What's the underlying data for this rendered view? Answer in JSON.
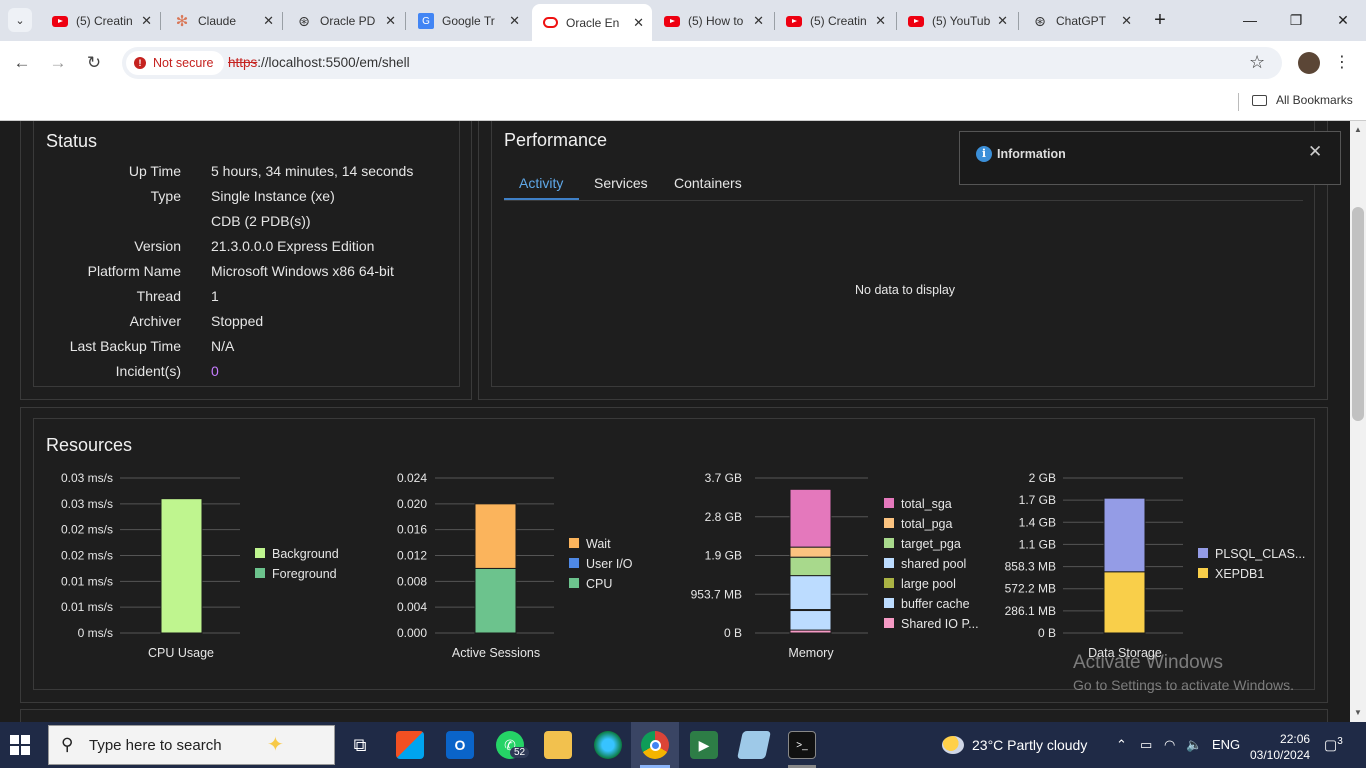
{
  "browser": {
    "tabs": [
      {
        "title": "(5) Creatin",
        "icon": "youtube-icon"
      },
      {
        "title": "Claude",
        "icon": "claude-icon"
      },
      {
        "title": "Oracle PD",
        "icon": "openai-icon"
      },
      {
        "title": "Google Tr",
        "icon": "google-translate-icon"
      },
      {
        "title": "Oracle En",
        "icon": "oracle-icon",
        "active": true
      },
      {
        "title": "(5) How to",
        "icon": "youtube-icon"
      },
      {
        "title": "(5) Creatin",
        "icon": "youtube-icon"
      },
      {
        "title": "(5) YouTub",
        "icon": "youtube-icon"
      },
      {
        "title": "ChatGPT",
        "icon": "openai-icon"
      }
    ],
    "security_chip": "Not secure",
    "url_scheme": "https",
    "url_rest": "://localhost:5500/em/shell",
    "all_bookmarks": "All Bookmarks"
  },
  "status": {
    "title": "Status",
    "rows": [
      {
        "label": "Up Time",
        "value": "5 hours, 34 minutes, 14 seconds"
      },
      {
        "label": "Type",
        "value": "Single Instance (xe)"
      },
      {
        "label": "",
        "value": "CDB (2 PDB(s))"
      },
      {
        "label": "Version",
        "value": "21.3.0.0.0 Express Edition"
      },
      {
        "label": "Platform Name",
        "value": "Microsoft Windows x86 64-bit"
      },
      {
        "label": "Thread",
        "value": "1"
      },
      {
        "label": "Archiver",
        "value": "Stopped"
      },
      {
        "label": "Last Backup Time",
        "value": "N/A"
      },
      {
        "label": "Incident(s)",
        "value": "0"
      }
    ],
    "link_color": "#c67cff"
  },
  "performance": {
    "title": "Performance",
    "tabs": [
      "Activity",
      "Services",
      "Containers"
    ],
    "active_tab": "Activity",
    "empty_message": "No data to display"
  },
  "info_toast": {
    "title": "Information"
  },
  "resources": {
    "title": "Resources"
  },
  "chart_data": [
    {
      "type": "bar",
      "stacked": true,
      "xlabel": "CPU Usage",
      "categories": [
        ""
      ],
      "yticks": [
        "0.03 ms/s",
        "0.03 ms/s",
        "0.02 ms/s",
        "0.02 ms/s",
        "0.01 ms/s",
        "0.01 ms/s",
        "0 ms/s"
      ],
      "ylim": [
        0,
        0.03
      ],
      "series": [
        {
          "name": "Background",
          "color": "#bff58f",
          "values": [
            0.026
          ]
        },
        {
          "name": "Foreground",
          "color": "#6cc38d",
          "values": [
            0
          ]
        }
      ],
      "legend": "right"
    },
    {
      "type": "bar",
      "stacked": true,
      "xlabel": "Active Sessions",
      "categories": [
        ""
      ],
      "yticks": [
        "0.024",
        "0.020",
        "0.016",
        "0.012",
        "0.008",
        "0.004",
        "0.000"
      ],
      "ylim": [
        0,
        0.024
      ],
      "series": [
        {
          "name": "Wait",
          "color": "#fbb45c",
          "values": [
            0.01
          ]
        },
        {
          "name": "User I/O",
          "color": "#4f89e6",
          "values": [
            0
          ]
        },
        {
          "name": "CPU",
          "color": "#6cc38d",
          "values": [
            0.01
          ]
        }
      ],
      "legend": "right"
    },
    {
      "type": "bar",
      "stacked": true,
      "xlabel": "Memory",
      "categories": [
        ""
      ],
      "yticks": [
        "3.7 GB",
        "2.8 GB",
        "1.9 GB",
        "953.7 MB",
        "0 B"
      ],
      "ylim": [
        0,
        3.7
      ],
      "series": [
        {
          "name": "total_sga",
          "color": "#e478bc",
          "values": [
            1.38
          ]
        },
        {
          "name": "total_pga",
          "color": "#fbc380",
          "values": [
            0.24
          ]
        },
        {
          "name": "target_pga",
          "color": "#a8d98c",
          "values": [
            0.44
          ]
        },
        {
          "name": "shared pool",
          "color": "#bcdcff",
          "values": [
            0.81
          ]
        },
        {
          "name": "large pool",
          "color": "#aab344",
          "values": [
            0.02
          ]
        },
        {
          "name": "buffer cache",
          "color": "#bcdcff",
          "values": [
            0.47
          ]
        },
        {
          "name": "Shared IO P...",
          "color": "#f59ac4",
          "values": [
            0.07
          ]
        }
      ],
      "legend": "right"
    },
    {
      "type": "bar",
      "stacked": true,
      "xlabel": "Data Storage",
      "categories": [
        ""
      ],
      "yticks": [
        "2 GB",
        "1.7 GB",
        "1.4 GB",
        "1.1 GB",
        "858.3 MB",
        "572.2 MB",
        "286.1 MB",
        "0 B"
      ],
      "ylim": [
        0,
        2.0
      ],
      "series": [
        {
          "name": "PLSQL_CLAS...",
          "color": "#949ce6",
          "values": [
            0.95
          ]
        },
        {
          "name": "XEPDB1",
          "color": "#f9cf4a",
          "values": [
            0.79
          ]
        }
      ],
      "legend": "right"
    }
  ],
  "watermark": {
    "line1": "Activate Windows",
    "line2": "Go to Settings to activate Windows."
  },
  "taskbar": {
    "search_placeholder": "Type here to search",
    "whatsapp_badge": "52",
    "weather": "23°C  Partly cloudy",
    "language": "ENG",
    "time": "22:06",
    "date": "03/10/2024",
    "notifications": "3"
  }
}
